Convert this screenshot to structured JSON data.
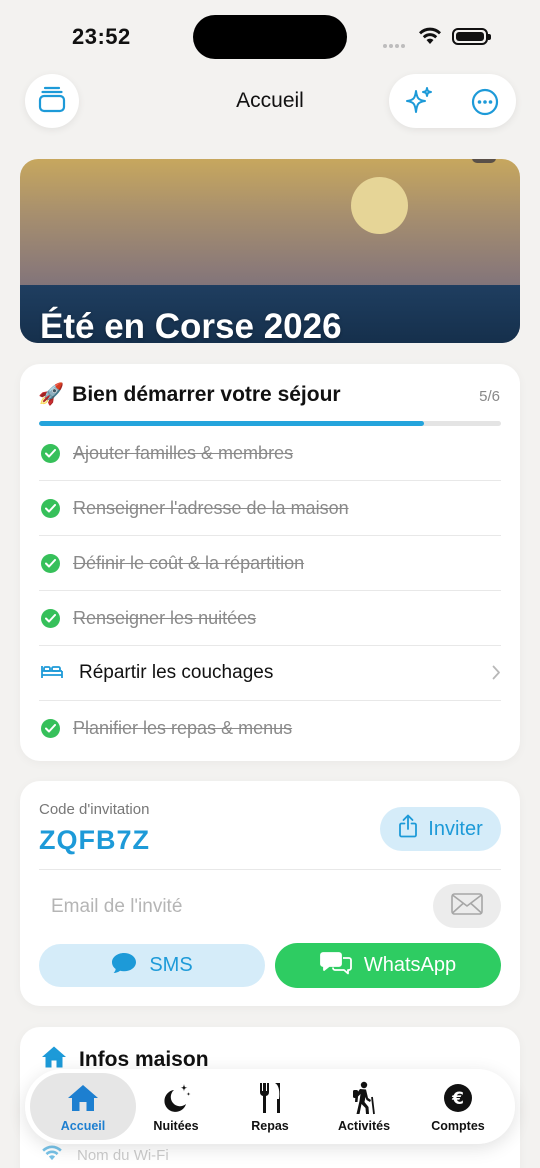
{
  "status_bar": {
    "time": "23:52"
  },
  "nav": {
    "title": "Accueil"
  },
  "hero": {
    "title": "Été en Corse 2026"
  },
  "checklist": {
    "emoji": "🚀",
    "title": "Bien démarrer votre séjour",
    "count": "5/6",
    "progress": 0.833,
    "items": [
      {
        "label": "Ajouter familles & membres",
        "done": true
      },
      {
        "label": "Renseigner l'adresse de la maison",
        "done": true
      },
      {
        "label": "Définir le coût & la répartition",
        "done": true
      },
      {
        "label": "Renseigner les nuitées",
        "done": true
      },
      {
        "label": "Répartir les couchages",
        "done": false,
        "icon": "bed-icon"
      },
      {
        "label": "Planifier les repas & menus",
        "done": true
      }
    ]
  },
  "invite": {
    "label": "Code d'invitation",
    "code": "ZQFB7Z",
    "invite_button": "Inviter",
    "email_placeholder": "Email de l'invité",
    "sms_button": "SMS",
    "whatsapp_button": "WhatsApp"
  },
  "house": {
    "title": "Infos maison",
    "wifi_label": "Nom du Wi-Fi"
  },
  "tabs": [
    {
      "label": "Accueil",
      "icon": "house-icon",
      "active": true
    },
    {
      "label": "Nuitées",
      "icon": "moon-stars-icon",
      "active": false
    },
    {
      "label": "Repas",
      "icon": "fork-knife-icon",
      "active": false
    },
    {
      "label": "Activités",
      "icon": "hiker-icon",
      "active": false
    },
    {
      "label": "Comptes",
      "icon": "euro-coin-icon",
      "active": false
    }
  ],
  "colors": {
    "accent": "#1d9ad8",
    "success": "#36c05a",
    "whatsapp": "#2ecc62",
    "progress": "#24a4dc"
  }
}
